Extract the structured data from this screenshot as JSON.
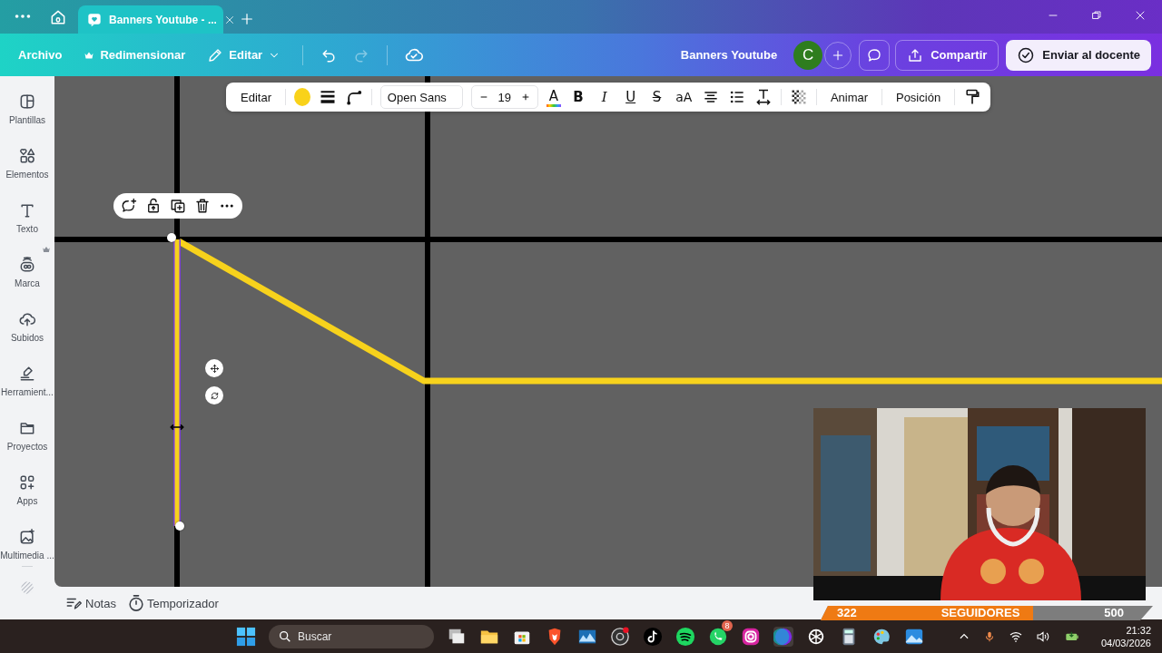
{
  "browser": {
    "tab": {
      "title": "Banners Youtube - ...",
      "selected": true
    }
  },
  "menu": {
    "items": [
      {
        "label": "Archivo",
        "kind": "plain"
      },
      {
        "label": "Redimensionar",
        "kind": "crown"
      },
      {
        "label": "Editar",
        "kind": "edit"
      }
    ],
    "undo": {
      "disabled": false
    },
    "redo": {
      "disabled": true
    }
  },
  "document_title": "Banners Youtube",
  "avatar": {
    "initial": "C",
    "color": "#2e7d1e"
  },
  "share": "Compartir",
  "submit": "Enviar al docente",
  "sidebar": {
    "items": [
      {
        "label": "Plantillas",
        "premium": false
      },
      {
        "label": "Elementos",
        "premium": false
      },
      {
        "label": "Texto",
        "premium": false
      },
      {
        "label": "Marca",
        "premium": true
      },
      {
        "label": "Subidos",
        "premium": false
      },
      {
        "label": "Herramient...",
        "premium": false
      },
      {
        "label": "Proyectos",
        "premium": false
      },
      {
        "label": "Apps",
        "premium": false
      },
      {
        "label": "Multimedia ...",
        "premium": false
      }
    ]
  },
  "text_toolbar": {
    "edit": "Editar",
    "color": "#f9d21a",
    "font": "Open Sans",
    "size": "19",
    "format_buttons": [
      {
        "label": "A",
        "kind": "color"
      },
      {
        "label": "B",
        "kind": "bold"
      },
      {
        "label": "I",
        "kind": "italic"
      },
      {
        "label": "U",
        "kind": "underline"
      },
      {
        "label": "S",
        "kind": "strike"
      },
      {
        "label": "aA",
        "kind": "case"
      }
    ],
    "animate": "Animar",
    "position": "Posición"
  },
  "footer": {
    "notes": "Notas",
    "timer": "Temporizador"
  },
  "followers": {
    "current": "322",
    "label": "SEGUIDORES",
    "goal": "500",
    "level": 0.64
  },
  "taskbar": {
    "search_placeholder": "Buscar",
    "badge": "8",
    "time": "21:32",
    "date": "04/03/2026"
  }
}
